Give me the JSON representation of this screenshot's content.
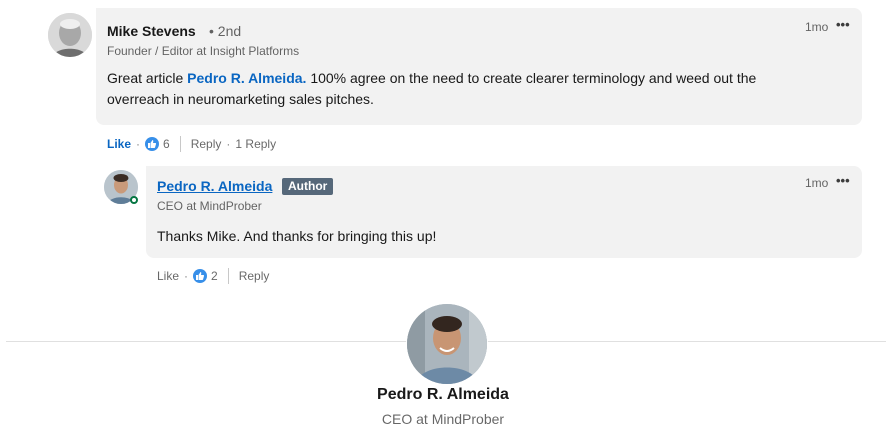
{
  "comment": {
    "author": "Mike Stevens",
    "degree": "• 2nd",
    "headline": "Founder / Editor at Insight Platforms",
    "time": "1mo",
    "more": "•••",
    "text_before": "Great article ",
    "mention": "Pedro R. Almeida.",
    "text_line1_after": " 100% agree on the need to create clearer terminology and weed out the",
    "text_line2": "overreach in neuromarketing sales pitches.",
    "actions": {
      "like": "Like",
      "dot1": "·",
      "like_count": "6",
      "reply": "Reply",
      "dot2": "·",
      "reply_count": "1 Reply"
    }
  },
  "reply": {
    "author": "Pedro R. Almeida",
    "badge": "Author",
    "headline": "CEO at MindProber",
    "time": "1mo",
    "more": "•••",
    "text": "Thanks Mike. And thanks for bringing this up!",
    "actions": {
      "like": "Like",
      "dot1": "·",
      "like_count": "2",
      "reply": "Reply"
    }
  },
  "footer": {
    "name": "Pedro R. Almeida",
    "role": "CEO at MindProber"
  },
  "icons": {
    "like_reaction": "thumbs-up-icon",
    "more": "more-options-icon",
    "online": "online-status-icon"
  },
  "colors": {
    "link": "#0a66c2",
    "bubble": "#f2f2f2",
    "badge": "#56687a",
    "like_icon": "#378fe9",
    "online": "#057642"
  }
}
